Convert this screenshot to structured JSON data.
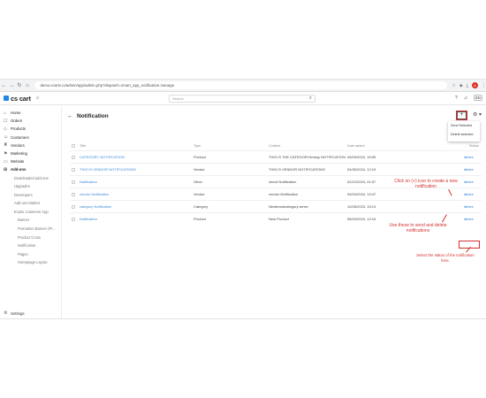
{
  "browser": {
    "url": "demo.ecartx.io/admin/app/admin.php?dispatch=smart_app_notification.manage",
    "nav": [
      "←",
      "→",
      "↻",
      "⌂"
    ],
    "icons": [
      "bookmark-icon",
      "extensions-icon",
      "download-icon"
    ],
    "profile": "A"
  },
  "header": {
    "logo": "cs cart",
    "search_placeholder": "Search",
    "user": "EN"
  },
  "sidebar": {
    "items": [
      {
        "label": "Home",
        "icon": "⌂"
      },
      {
        "label": "Orders",
        "icon": "☐"
      },
      {
        "label": "Products",
        "icon": "◇"
      },
      {
        "label": "Customers",
        "icon": "☺"
      },
      {
        "label": "Vendors",
        "icon": "♜"
      },
      {
        "label": "Marketing",
        "icon": "⚑"
      },
      {
        "label": "Website",
        "icon": "▭"
      },
      {
        "label": "Add-ons",
        "icon": "⊞"
      }
    ],
    "subitems": [
      "Downloaded add-ons",
      "Upgrades",
      "Developers",
      "Add-ons Market",
      "Ecartx Customer App"
    ],
    "deep_items": [
      "Banner",
      "Promotion Banner (Pr...",
      "Product Cross",
      "Notification",
      "Pages",
      "Homepage Layout"
    ],
    "settings": "Settings"
  },
  "page": {
    "title": "Notification",
    "add_label": "+",
    "gear_label": "⚙ ▾"
  },
  "dropdown": {
    "items": [
      "Send Selected",
      "Delete selected"
    ]
  },
  "table": {
    "headers": {
      "title": "Title",
      "type": "Type",
      "content": "Content",
      "date": "Date added",
      "status": "Status"
    },
    "rows": [
      {
        "title": "CATEGORY NOTIFICATION",
        "type": "Product",
        "content": "THIS IS THE CATEGORY/imbuy NOTIFICATION",
        "date": "05/09/2024, 15:05",
        "status": "Active"
      },
      {
        "title": "THIS IS VENDOR NOTIFICATIONS",
        "type": "Vendor",
        "content": "THIS IS VENDOR NOTIFICATIONS",
        "date": "04/30/2024, 12:19",
        "status": "Active"
      },
      {
        "title": "Notification",
        "type": "Other",
        "content": "check Notification",
        "date": "02/12/2024, 01:57",
        "status": "Active"
      },
      {
        "title": "vendor Notification",
        "type": "Vendor",
        "content": "vendor Notification",
        "date": "09/24/2024, 13:47",
        "status": "Active"
      },
      {
        "title": "category Notification",
        "type": "Category",
        "content": "Newbrandcategory arrive",
        "date": "10/26/2023, 15:13",
        "status": "Active"
      },
      {
        "title": "Notification",
        "type": "Product",
        "content": "New Product",
        "date": "08/20/2024, 12:16",
        "status": "Active"
      }
    ]
  },
  "annotations": {
    "add": "Click on (+) icon to create a new notification",
    "bulk": "Use these to send and delete notifications",
    "status": "Select the status of the notification here."
  },
  "colors": {
    "accent": "#3b8ad9",
    "annotation": "#d32f2f"
  }
}
